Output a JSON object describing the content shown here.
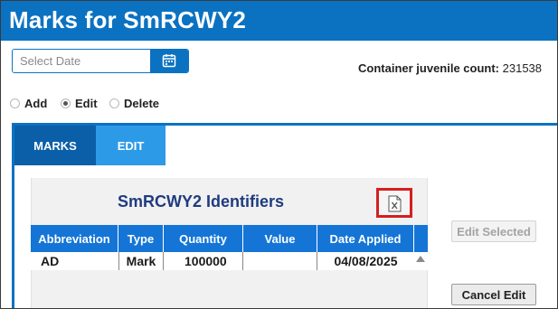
{
  "header": {
    "title": "Marks for SmRCWY2"
  },
  "date_picker": {
    "placeholder": "Select Date",
    "icon": "calendar-icon"
  },
  "container_count": {
    "label": "Container juvenile count:",
    "value": "231538"
  },
  "mode": {
    "options": [
      {
        "label": "Add",
        "checked": false
      },
      {
        "label": "Edit",
        "checked": true
      },
      {
        "label": "Delete",
        "checked": false
      }
    ]
  },
  "tabs": [
    {
      "label": "MARKS",
      "active": false
    },
    {
      "label": "EDIT",
      "active": true
    }
  ],
  "grid": {
    "title": "SmRCWY2 Identifiers",
    "export_icon": "excel-export-icon",
    "columns": [
      "Abbreviation",
      "Type",
      "Quantity",
      "Value",
      "Date Applied"
    ],
    "rows": [
      [
        "AD",
        "Mark",
        "100000",
        "",
        "04/08/2025"
      ]
    ]
  },
  "buttons": {
    "edit_selected": "Edit Selected",
    "cancel_edit": "Cancel Edit"
  },
  "colors": {
    "brand_blue": "#0b72c2",
    "active_tab": "#0b5fa8",
    "edit_tab": "#2d9ae8",
    "grid_header": "#1475d6",
    "title_navy": "#1f3b80",
    "highlight_red": "#d41f1f"
  }
}
